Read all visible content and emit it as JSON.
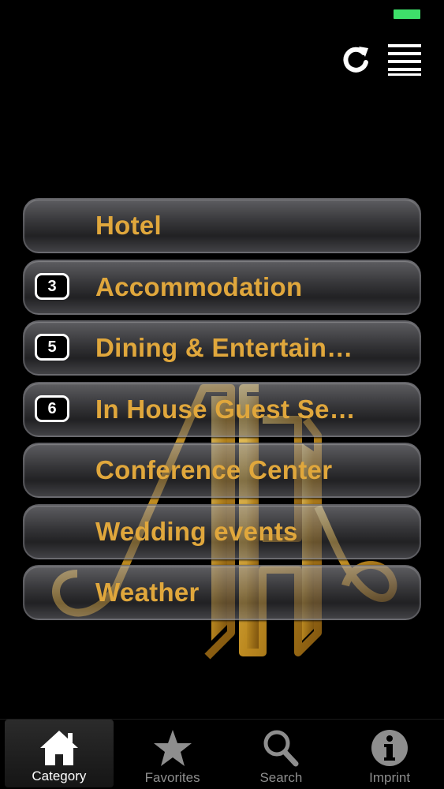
{
  "toolbar": {
    "refresh_icon": "refresh-icon",
    "menu_icon": "list-menu-icon"
  },
  "colors": {
    "accent_gold": "#e0a73c",
    "battery": "#3ee06a",
    "background": "#000000"
  },
  "menu": {
    "items": [
      {
        "label": "Hotel",
        "badge": ""
      },
      {
        "label": "Accommodation",
        "badge": "3"
      },
      {
        "label": "Dining & Entertain…",
        "badge": "5"
      },
      {
        "label": "In House Guest Se…",
        "badge": "6"
      },
      {
        "label": "Conference Center",
        "badge": ""
      },
      {
        "label": "Wedding events",
        "badge": ""
      },
      {
        "label": "Weather",
        "badge": ""
      }
    ]
  },
  "tabs": [
    {
      "label": "Category",
      "icon": "home-icon",
      "active": true
    },
    {
      "label": "Favorites",
      "icon": "star-icon",
      "active": false
    },
    {
      "label": "Search",
      "icon": "magnifier-icon",
      "active": false
    },
    {
      "label": "Imprint",
      "icon": "info-icon",
      "active": false
    }
  ]
}
